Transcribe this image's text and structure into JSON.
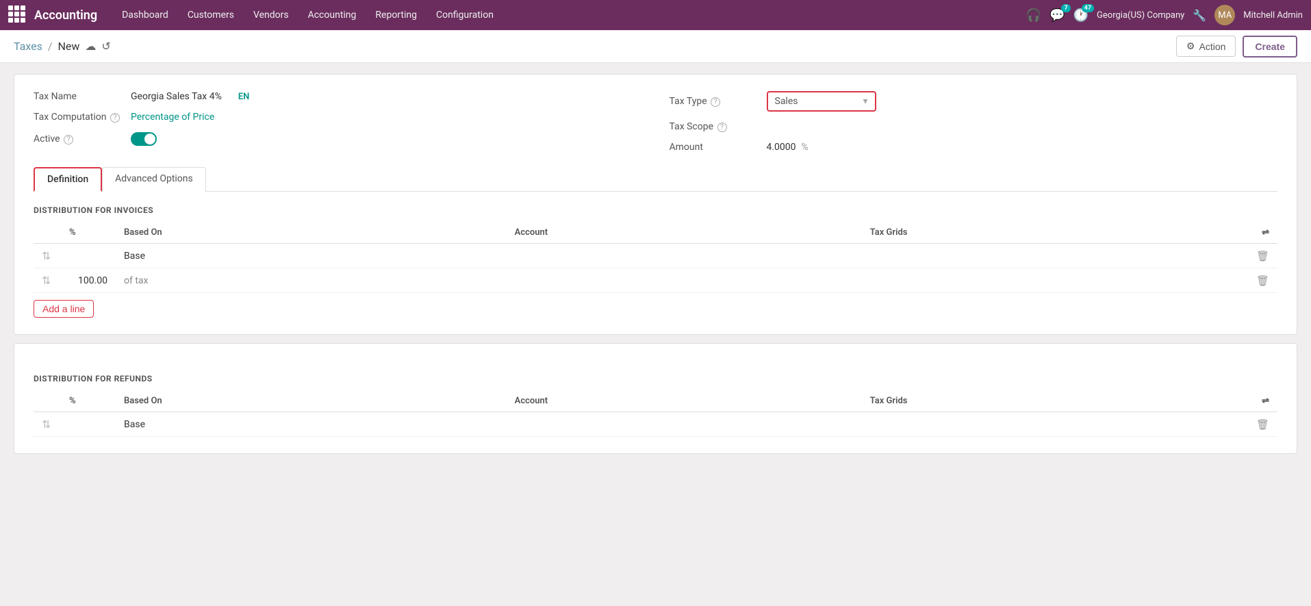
{
  "app": {
    "brand": "Accounting",
    "nav_items": [
      "Dashboard",
      "Customers",
      "Vendors",
      "Accounting",
      "Reporting",
      "Configuration"
    ],
    "notifications_count": "7",
    "clock_count": "47",
    "company": "Georgia(US) Company",
    "username": "Mitchell Admin"
  },
  "breadcrumb": {
    "parent": "Taxes",
    "current": "New",
    "action_label": "Action",
    "create_label": "Create"
  },
  "form": {
    "tax_name_label": "Tax Name",
    "tax_name_value": "Georgia Sales Tax 4%",
    "en_label": "EN",
    "tax_type_label": "Tax Type",
    "tax_type_value": "Sales",
    "tax_computation_label": "Tax Computation",
    "tax_computation_value": "Percentage of Price",
    "tax_scope_label": "Tax Scope",
    "tax_scope_value": "",
    "active_label": "Active",
    "amount_label": "Amount",
    "amount_value": "4.0000",
    "amount_unit": "%"
  },
  "tabs": [
    {
      "id": "definition",
      "label": "Definition",
      "active": true
    },
    {
      "id": "advanced",
      "label": "Advanced Options",
      "active": false
    }
  ],
  "distribution_invoices": {
    "title": "DISTRIBUTION FOR INVOICES",
    "columns": {
      "pct": "%",
      "based_on": "Based On",
      "account": "Account",
      "tax_grids": "Tax Grids"
    },
    "rows": [
      {
        "pct": "",
        "based_on": "Base",
        "account": "",
        "tax_grids": ""
      },
      {
        "pct": "100.00",
        "based_on": "of tax",
        "account": "",
        "tax_grids": ""
      }
    ],
    "add_line_label": "Add a line"
  },
  "distribution_refunds": {
    "title": "DISTRIBUTION FOR REFUNDS",
    "columns": {
      "pct": "%",
      "based_on": "Based On",
      "account": "Account",
      "tax_grids": "Tax Grids"
    },
    "rows": [
      {
        "pct": "",
        "based_on": "Base",
        "account": "",
        "tax_grids": ""
      }
    ]
  }
}
